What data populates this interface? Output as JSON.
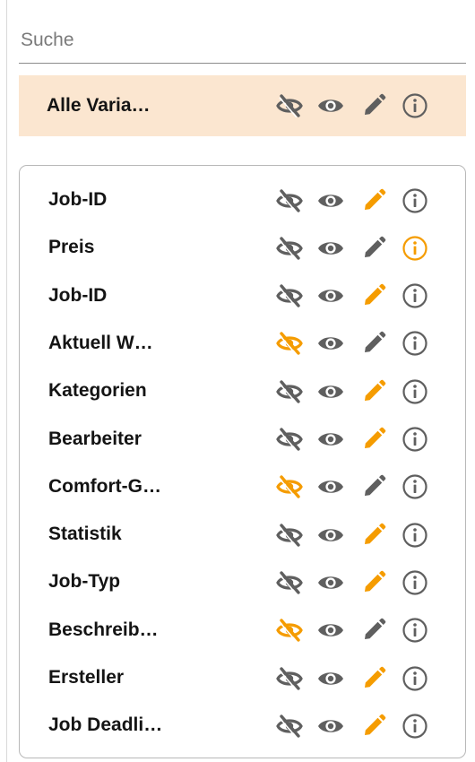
{
  "search": {
    "placeholder": "Suche",
    "value": ""
  },
  "colors": {
    "accent": "#f59c00",
    "icon_default": "#5f5f5f",
    "highlight_bg": "#fbe6d0"
  },
  "all_variables": {
    "label": "Alle Varia…",
    "icons": {
      "hide": "default",
      "view": "default",
      "edit": "default",
      "info": "default"
    }
  },
  "rows": [
    {
      "label": "Job-ID",
      "icons": {
        "hide": "default",
        "view": "default",
        "edit": "accent",
        "info": "default"
      }
    },
    {
      "label": "Preis",
      "icons": {
        "hide": "default",
        "view": "default",
        "edit": "default",
        "info": "accent"
      }
    },
    {
      "label": "Job-ID",
      "icons": {
        "hide": "default",
        "view": "default",
        "edit": "accent",
        "info": "default"
      }
    },
    {
      "label": "Aktuell W…",
      "icons": {
        "hide": "accent",
        "view": "default",
        "edit": "default",
        "info": "default"
      }
    },
    {
      "label": "Kategorien",
      "icons": {
        "hide": "default",
        "view": "default",
        "edit": "accent",
        "info": "default"
      }
    },
    {
      "label": "Bearbeiter",
      "icons": {
        "hide": "default",
        "view": "default",
        "edit": "accent",
        "info": "default"
      }
    },
    {
      "label": "Comfort-G…",
      "icons": {
        "hide": "accent",
        "view": "default",
        "edit": "default",
        "info": "default"
      }
    },
    {
      "label": "Statistik",
      "icons": {
        "hide": "default",
        "view": "default",
        "edit": "accent",
        "info": "default"
      }
    },
    {
      "label": "Job-Typ",
      "icons": {
        "hide": "default",
        "view": "default",
        "edit": "accent",
        "info": "default"
      }
    },
    {
      "label": "Beschreib…",
      "icons": {
        "hide": "accent",
        "view": "default",
        "edit": "default",
        "info": "default"
      }
    },
    {
      "label": "Ersteller",
      "icons": {
        "hide": "default",
        "view": "default",
        "edit": "accent",
        "info": "default"
      }
    },
    {
      "label": "Job Deadli…",
      "icons": {
        "hide": "default",
        "view": "default",
        "edit": "accent",
        "info": "default"
      }
    }
  ]
}
